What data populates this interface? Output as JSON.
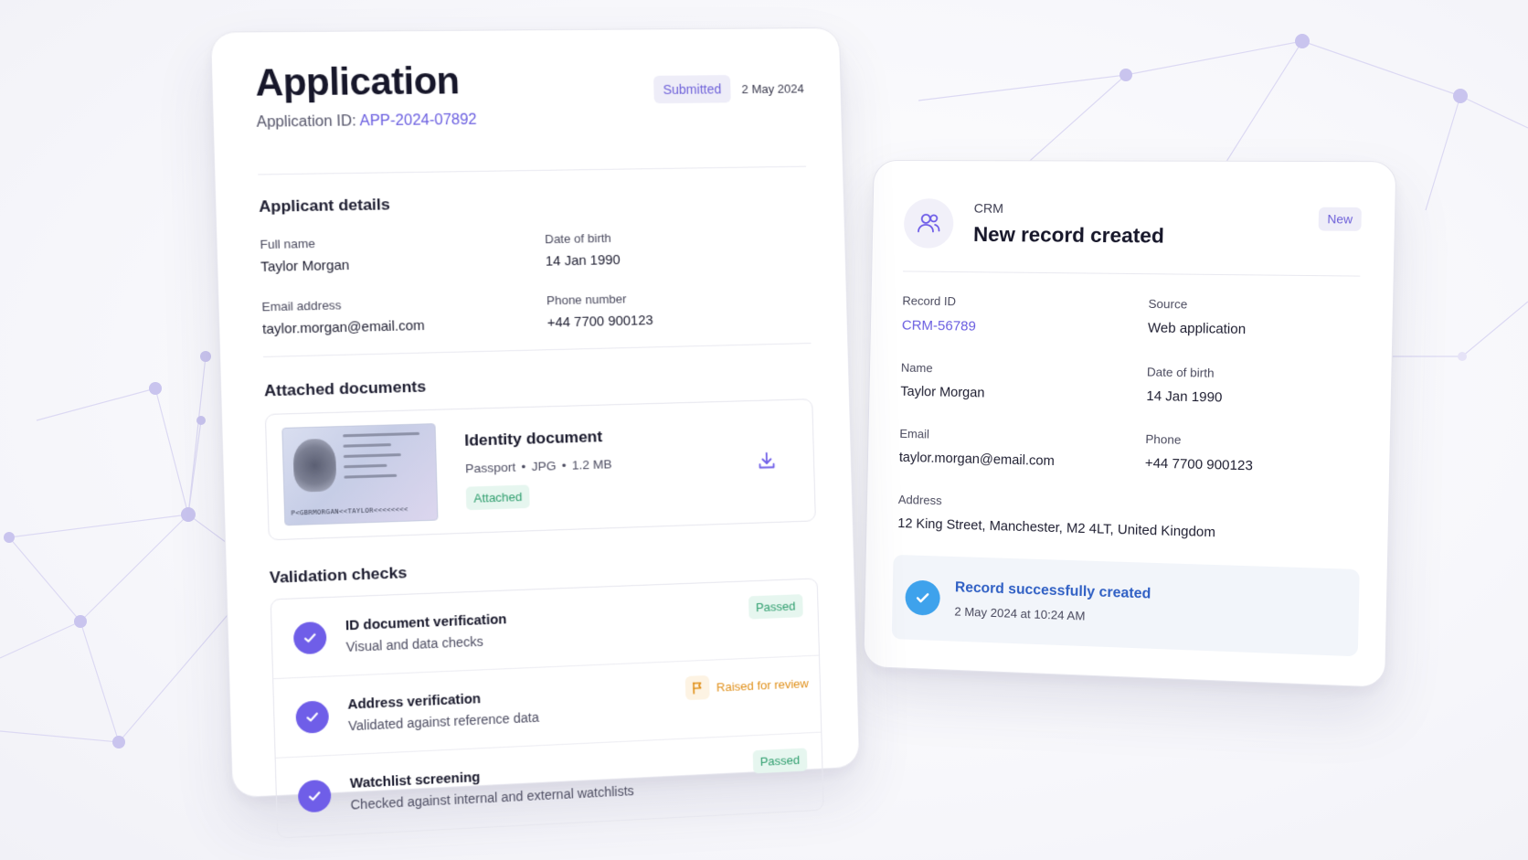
{
  "application": {
    "title": "Application",
    "id_label": "Application ID:",
    "id_value": "APP-2024-07892",
    "status": "Submitted",
    "date": "2 May 2024",
    "applicant_section": "Applicant details",
    "fields": [
      {
        "label": "Full name",
        "value": "Taylor Morgan"
      },
      {
        "label": "Date of birth",
        "value": "14 Jan 1990"
      },
      {
        "label": "Email address",
        "value": "taylor.morgan@email.com"
      },
      {
        "label": "Phone number",
        "value": "+44 7700 900123"
      }
    ],
    "documents_section": "Attached documents",
    "document": {
      "title": "Identity document",
      "type": "Passport",
      "format": "JPG",
      "size": "1.2 MB",
      "status": "Attached",
      "icon": "download-icon",
      "passport_image": {
        "header": "INTERNATIONAL PASSPORT",
        "surname": "MORGAN",
        "given_name": "TAYLOR",
        "mrz": "P<GBRMORGAN<<TAYLOR<<<<<<<<<"
      }
    },
    "checks_section": "Validation checks",
    "checks": [
      {
        "title": "ID document verification",
        "subtitle": "Visual and data checks",
        "status": "Passed",
        "status_type": "passed"
      },
      {
        "title": "Address verification",
        "subtitle": "Validated against reference data",
        "status": "Raised for review",
        "status_type": "review"
      },
      {
        "title": "Watchlist screening",
        "subtitle": "Checked against internal and external watchlists",
        "status": "Passed",
        "status_type": "passed"
      }
    ]
  },
  "crm": {
    "label": "CRM",
    "title": "New record created",
    "badge": "New",
    "icon": "users-icon",
    "fields": {
      "record_id": {
        "label": "Record ID",
        "value": "CRM-56789"
      },
      "source": {
        "label": "Source",
        "value": "Web application"
      },
      "name": {
        "label": "Name",
        "value": "Taylor Morgan"
      },
      "dob": {
        "label": "Date of birth",
        "value": "14 Jan 1990"
      },
      "email": {
        "label": "Email",
        "value": "taylor.morgan@email.com"
      },
      "phone": {
        "label": "Phone",
        "value": "+44 7700 900123"
      },
      "address": {
        "label": "Address",
        "value": "12 King Street, Manchester, M2 4LT, United Kingdom"
      }
    },
    "success": {
      "title": "Record successfully created",
      "timestamp": "2 May 2024 at 10:24 AM"
    }
  },
  "colors": {
    "accent": "#6f5ee8",
    "link": "#6a5ee0",
    "success": "#2f9e6e",
    "warning": "#e0901a",
    "info": "#3ea2ec",
    "network": "#c9c4ee"
  }
}
